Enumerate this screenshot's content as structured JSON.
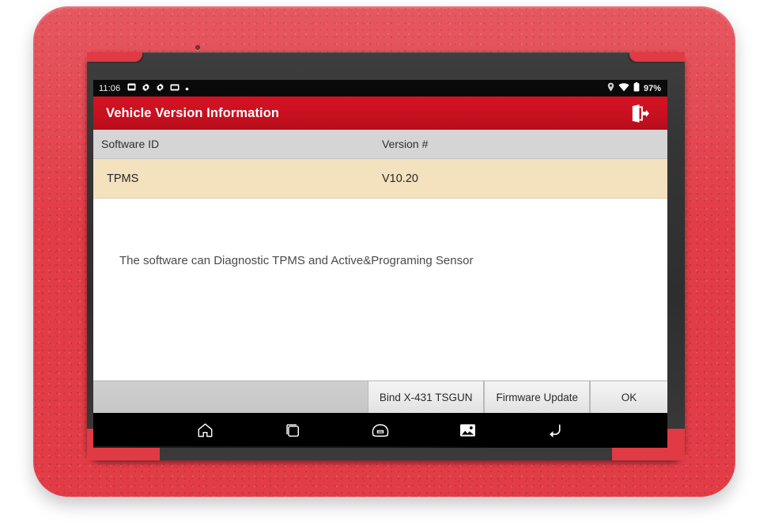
{
  "device": {
    "case_color": "#e03a44",
    "bezel_color": "#353535",
    "camera_label": "front-camera"
  },
  "status_bar": {
    "clock": "11:06",
    "battery_percent": "97%",
    "left_icons": [
      "sd-card-icon",
      "settings-gear-icon",
      "settings-gear-icon",
      "sd-card-icon",
      "dot-icon"
    ],
    "right_icons": [
      "location-icon",
      "wifi-icon",
      "battery-icon"
    ]
  },
  "title_bar": {
    "title": "Vehicle Version Information",
    "background_color": "#c8101f",
    "exit_icon": "exit-door-icon"
  },
  "table": {
    "columns": [
      "Software ID",
      "Version #"
    ],
    "header_background": "#d5d5d5",
    "row_background": "#f4e1bd",
    "rows": [
      {
        "software_id": "TPMS",
        "version": "V10.20"
      }
    ]
  },
  "content": {
    "description": "The software can Diagnostic TPMS and Active&Programing Sensor"
  },
  "footer": {
    "buttons": [
      {
        "label": "Bind X-431 TSGUN",
        "name": "bind-tsgun-button"
      },
      {
        "label": "Firmware Update",
        "name": "firmware-update-button"
      },
      {
        "label": "OK",
        "name": "ok-button"
      }
    ],
    "background_color": "#c6c6c6"
  },
  "nav_bar": {
    "items": [
      "home-icon",
      "recents-icon",
      "vci-connector-icon",
      "screenshot-image-icon",
      "back-icon"
    ]
  }
}
